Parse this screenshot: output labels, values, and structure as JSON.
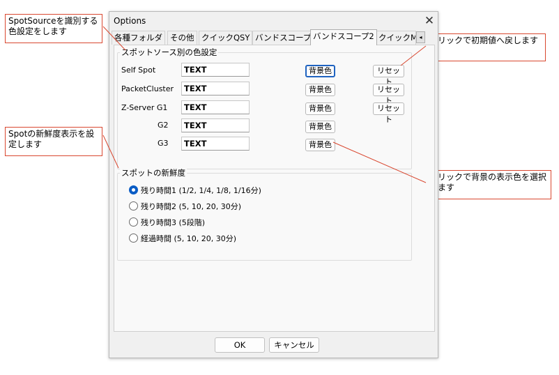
{
  "window": {
    "title": "Options",
    "close_glyph": "✕"
  },
  "tabs": [
    {
      "label": "各種フォルダ",
      "active": false
    },
    {
      "label": "その他",
      "active": false
    },
    {
      "label": "クイックQSY",
      "active": false
    },
    {
      "label": "バンドスコープ",
      "active": false
    },
    {
      "label": "バンドスコープ2",
      "active": true
    },
    {
      "label": "クイックMe",
      "active": false
    }
  ],
  "tab_scroll_glyph": "◂",
  "color_group": {
    "title": "スポットソース別の色設定",
    "rows": [
      {
        "label": "Self Spot",
        "text": "TEXT",
        "bg_button": "背景色",
        "reset_button": "リセット"
      },
      {
        "label": "PacketCluster",
        "text": "TEXT",
        "bg_button": "背景色",
        "reset_button": "リセット"
      },
      {
        "label": "Z-Server G1",
        "text": "TEXT",
        "bg_button": "背景色",
        "reset_button": "リセット"
      },
      {
        "label": "G2",
        "text": "TEXT",
        "bg_button": "背景色"
      },
      {
        "label": "G3",
        "text": "TEXT",
        "bg_button": "背景色"
      }
    ]
  },
  "freshness_group": {
    "title": "スポットの新鮮度",
    "options": [
      {
        "label": "残り時間1 (1/2, 1/4, 1/8, 1/16分)",
        "selected": true
      },
      {
        "label": "残り時間2 (5, 10, 20, 30分)",
        "selected": false
      },
      {
        "label": "残り時間3 (5段階)",
        "selected": false
      },
      {
        "label": "経過時間 (5, 10, 20, 30分)",
        "selected": false
      }
    ]
  },
  "buttons": {
    "ok": "OK",
    "cancel": "キャンセル"
  },
  "annotations": [
    {
      "text": "SpotSourceを識別する色設定をします"
    },
    {
      "text": "Spotの新鮮度表示を設定します"
    },
    {
      "text": "クリックで初期値へ戻します"
    },
    {
      "text": "クリックで背景の表示色を選択します"
    }
  ],
  "colors": {
    "accent": "#0a5cc5",
    "callout_border": "#d9472f",
    "dialog_bg": "#f0f0f0",
    "panel_bg": "#f9f9f9"
  }
}
